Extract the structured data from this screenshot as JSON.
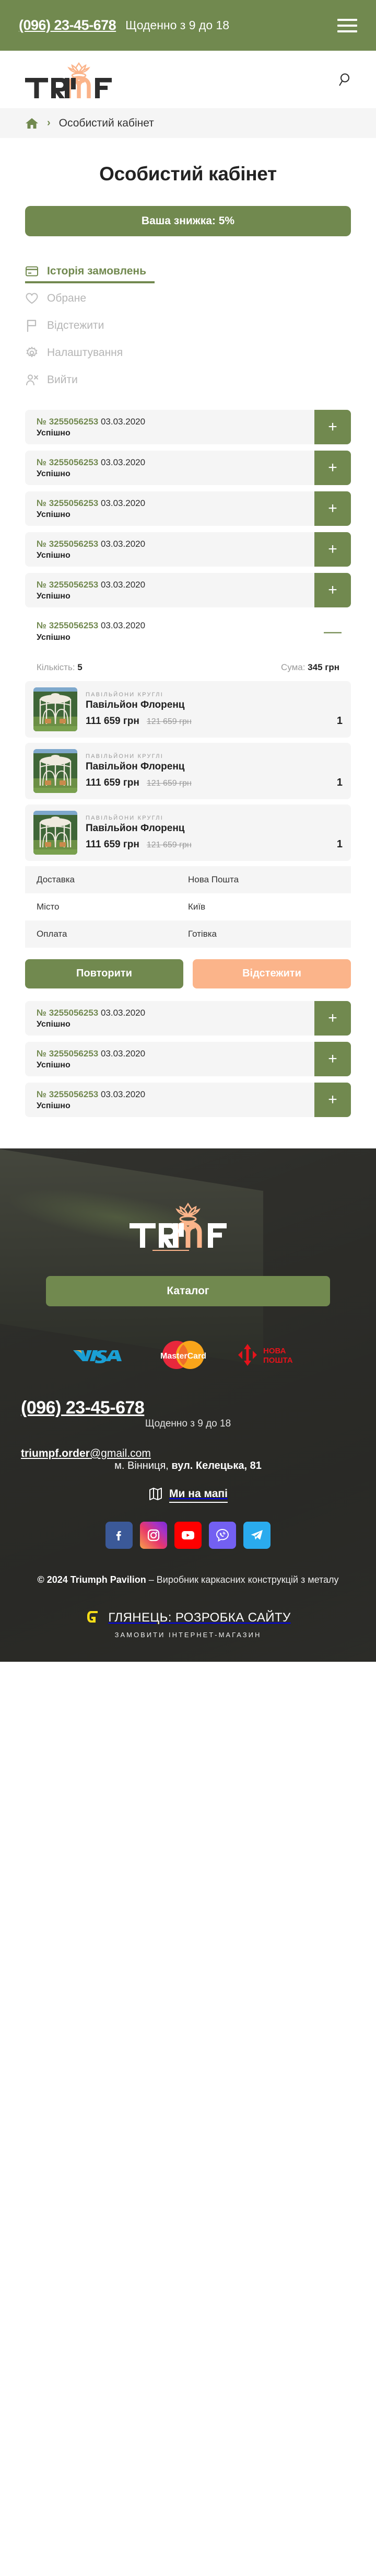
{
  "topbar": {
    "phone": "(096) 23-45-678",
    "hours": "Щоденно з 9 до 18",
    "menu_icon": "hamburger-menu-icon"
  },
  "header": {
    "logo_text": "TRIUMF",
    "search_icon": "search-icon"
  },
  "breadcrumb": {
    "home_icon": "home-icon",
    "separator": "›",
    "current": "Особистий кабінет"
  },
  "page": {
    "title": "Особистий кабінет",
    "discount_banner": "Ваша знижка: 5%"
  },
  "account_nav": [
    {
      "label": "Історія замовлень",
      "icon": "card-icon",
      "active": true
    },
    {
      "label": "Обране",
      "icon": "heart-icon",
      "active": false
    },
    {
      "label": "Відстежити",
      "icon": "flag-icon",
      "active": false
    },
    {
      "label": "Налаштування",
      "icon": "gear-icon",
      "active": false
    },
    {
      "label": "Вийти",
      "icon": "logout-user-icon",
      "active": false
    }
  ],
  "orders_before": [
    {
      "prefix": "№",
      "number": "3255056253",
      "date": "03.03.2020",
      "status": "Успішно",
      "toggle": "+"
    },
    {
      "prefix": "№",
      "number": "3255056253",
      "date": "03.03.2020",
      "status": "Успішно",
      "toggle": "+"
    },
    {
      "prefix": "№",
      "number": "3255056253",
      "date": "03.03.2020",
      "status": "Успішно",
      "toggle": "+"
    },
    {
      "prefix": "№",
      "number": "3255056253",
      "date": "03.03.2020",
      "status": "Успішно",
      "toggle": "+"
    },
    {
      "prefix": "№",
      "number": "3255056253",
      "date": "03.03.2020",
      "status": "Успішно",
      "toggle": "+"
    }
  ],
  "expanded_order": {
    "prefix": "№",
    "number": "3255056253",
    "date": "03.03.2020",
    "status": "Успішно",
    "toggle": "—",
    "summary": {
      "qty_label": "Кількість:",
      "qty_value": "5",
      "sum_label": "Сума:",
      "sum_value": "345 грн"
    },
    "products": [
      {
        "category": "ПАВІЛЬЙОНИ КРУГЛІ",
        "name": "Павільйон Флоренц",
        "price": "111 659 грн",
        "old_price": "121 659 грн",
        "qty": "1"
      },
      {
        "category": "ПАВІЛЬЙОНИ КРУГЛІ",
        "name": "Павільйон Флоренц",
        "price": "111 659 грн",
        "old_price": "121 659 грн",
        "qty": "1"
      },
      {
        "category": "ПАВІЛЬЙОНИ КРУГЛІ",
        "name": "Павільйон Флоренц",
        "price": "111 659 грн",
        "old_price": "121 659 грн",
        "qty": "1"
      }
    ],
    "details": [
      {
        "key": "Доставка",
        "value": "Нова Пошта"
      },
      {
        "key": "Місто",
        "value": "Київ"
      },
      {
        "key": "Оплата",
        "value": "Готівка"
      }
    ],
    "actions": {
      "repeat": "Повторити",
      "track": "Відстежити"
    }
  },
  "orders_after": [
    {
      "prefix": "№",
      "number": "3255056253",
      "date": "03.03.2020",
      "status": "Успішно",
      "toggle": "+"
    },
    {
      "prefix": "№",
      "number": "3255056253",
      "date": "03.03.2020",
      "status": "Успішно",
      "toggle": "+"
    },
    {
      "prefix": "№",
      "number": "3255056253",
      "date": "03.03.2020",
      "status": "Успішно",
      "toggle": "+"
    }
  ],
  "footer": {
    "logo_text": "TRIUMF",
    "catalog_button": "Каталог",
    "payments": [
      {
        "name": "VISA",
        "icon": "visa-logo"
      },
      {
        "name": "MasterCard",
        "icon": "mastercard-logo"
      },
      {
        "name": "НОВА ПОШТА",
        "icon": "nova-poshta-logo"
      }
    ],
    "phone": "(096) 23-45-678",
    "hours": "Щоденно з 9 до 18",
    "email_user": "triumpf.order",
    "email_domain": "@gmail.com",
    "address_city": "м. Вінниця, ",
    "address_street": "вул. Келецька, 81",
    "map_icon": "map-icon",
    "map_label": "Ми на мапі",
    "socials": [
      {
        "name": "Facebook",
        "icon": "facebook-icon"
      },
      {
        "name": "Instagram",
        "icon": "instagram-icon"
      },
      {
        "name": "YouTube",
        "icon": "youtube-icon"
      },
      {
        "name": "Viber",
        "icon": "viber-icon"
      },
      {
        "name": "Telegram",
        "icon": "telegram-icon"
      }
    ],
    "copyright_bold": "© 2024 Triumph Pavilion",
    "copyright_rest": " – Виробник каркасних конструкцій з металу",
    "developer_title": "ГЛЯНЕЦЬ: РОЗРОБКА САЙТУ",
    "developer_sub": "ЗАМОВИТИ ІНТЕРНЕТ-МАГАЗИН",
    "developer_icon": "glyanets-logo"
  },
  "colors": {
    "brand_green": "#71894f",
    "brand_peach": "#fbb48a",
    "surface_grey": "#f5f5f5",
    "footer_dark": "#3a3a36"
  }
}
